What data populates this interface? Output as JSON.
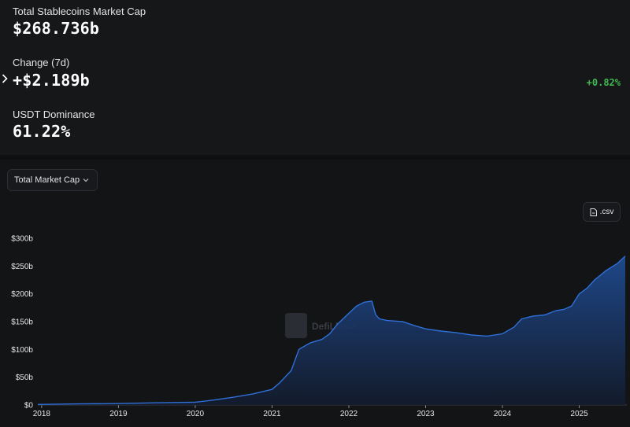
{
  "stats": {
    "market_cap": {
      "label": "Total Stablecoins Market Cap",
      "value": "$268.736b"
    },
    "change": {
      "label": "Change (7d)",
      "value": "+$2.189b",
      "percent": "+0.82%",
      "expand_icon": "chevron-right-icon"
    },
    "dominance": {
      "label": "USDT Dominance",
      "value": "61.22%"
    }
  },
  "controls": {
    "metric_select": {
      "value": "Total Market Cap",
      "icon": "chevron-down-icon"
    },
    "csv_button": {
      "label": ".csv",
      "icon": "file-icon"
    }
  },
  "watermark": {
    "text": "DefiLlama"
  },
  "colors": {
    "line": "#2f6fd6",
    "fill_top": "#1f4a8f",
    "fill_bottom": "#131c2e",
    "positive": "#3fb950"
  },
  "chart_data": {
    "type": "area",
    "title": "",
    "xlabel": "",
    "ylabel": "",
    "ylim": [
      0,
      300
    ],
    "xlim": [
      2017.95,
      2025.62
    ],
    "y_ticks": [
      "$0",
      "$50b",
      "$100b",
      "$150b",
      "$200b",
      "$250b",
      "$300b"
    ],
    "y_tick_values": [
      0,
      50,
      100,
      150,
      200,
      250,
      300
    ],
    "x_ticks": [
      "2018",
      "2019",
      "2020",
      "2021",
      "2022",
      "2023",
      "2024",
      "2025"
    ],
    "x_tick_values": [
      2018,
      2019,
      2020,
      2021,
      2022,
      2023,
      2024,
      2025
    ],
    "grid": false,
    "legend": "none",
    "series": [
      {
        "x": [
          2017.95,
          2018.5,
          2019.0,
          2019.5,
          2020.0,
          2020.25,
          2020.5,
          2020.75,
          2021.0,
          2021.1,
          2021.25,
          2021.35,
          2021.5,
          2021.65,
          2021.75,
          2021.85,
          2022.0,
          2022.1,
          2022.2,
          2022.3,
          2022.35,
          2022.4,
          2022.5,
          2022.7,
          2022.85,
          2023.0,
          2023.2,
          2023.4,
          2023.6,
          2023.8,
          2024.0,
          2024.15,
          2024.25,
          2024.4,
          2024.55,
          2024.7,
          2024.8,
          2024.9,
          2025.0,
          2025.1,
          2025.2,
          2025.35,
          2025.5,
          2025.6
        ],
        "y": [
          1,
          2,
          2.5,
          4,
          5,
          9,
          14,
          20,
          28,
          40,
          62,
          100,
          112,
          118,
          128,
          145,
          165,
          178,
          185,
          187,
          162,
          155,
          152,
          150,
          143,
          137,
          133,
          130,
          126,
          124,
          128,
          140,
          155,
          160,
          162,
          170,
          172,
          178,
          200,
          210,
          225,
          242,
          255,
          268
        ]
      }
    ]
  }
}
